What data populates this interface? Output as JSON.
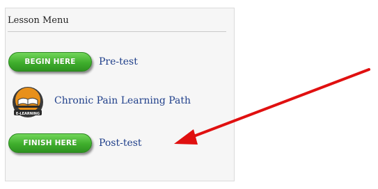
{
  "lesson_menu": {
    "title": "Lesson Menu",
    "items": [
      {
        "button_label": "BEGIN HERE",
        "link_label": "Pre-test"
      },
      {
        "icon_label": "E-LEARNING",
        "link_label": "Chronic Pain Learning Path"
      },
      {
        "button_label": "FINISH HERE",
        "link_label": "Post-test"
      }
    ]
  },
  "colors": {
    "button_green": "#3fae2c",
    "link_blue": "#1f3f8a",
    "arrow_red": "#e01010",
    "icon_orange": "#e8901a"
  },
  "icons": {
    "elearning": "open-book-icon",
    "annotation": "red-arrow-icon"
  }
}
